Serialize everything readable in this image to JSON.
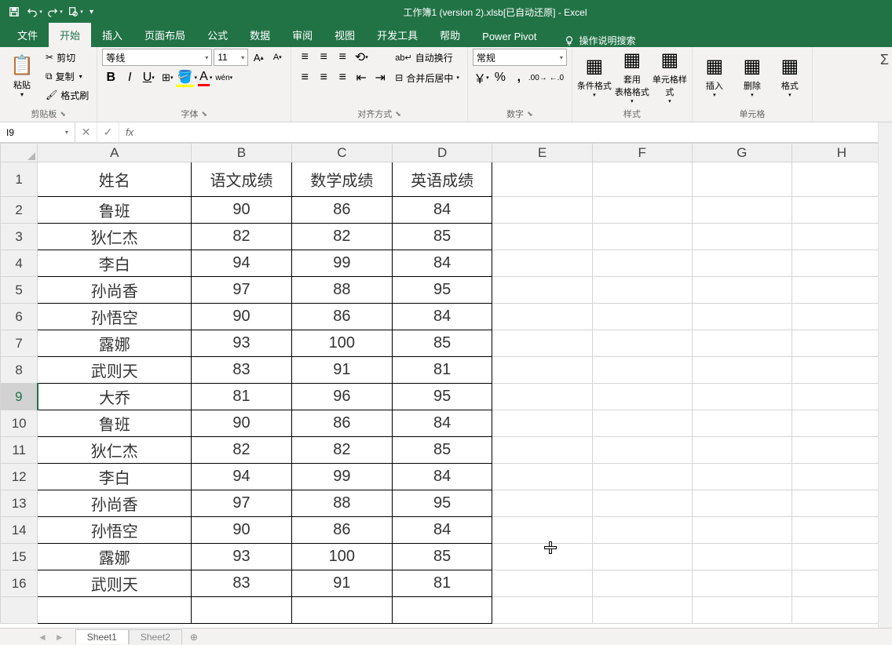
{
  "title": "工作簿1 (version 2).xlsb[已自动还原]  -  Excel",
  "ribbonTabs": [
    "文件",
    "开始",
    "插入",
    "页面布局",
    "公式",
    "数据",
    "审阅",
    "视图",
    "开发工具",
    "帮助",
    "Power Pivot"
  ],
  "activeTab": "开始",
  "tellMe": "操作说明搜索",
  "nameBox": "I9",
  "formula": "",
  "clipboard": {
    "paste": "粘贴",
    "cut": "剪切",
    "copy": "复制",
    "formatPainter": "格式刷",
    "group": "剪贴板"
  },
  "font": {
    "family": "等线",
    "size": "11",
    "group": "字体"
  },
  "alignment": {
    "wrap": "自动换行",
    "merge": "合并后居中",
    "group": "对齐方式"
  },
  "number": {
    "format": "常规",
    "group": "数字"
  },
  "styles": {
    "conditional": "条件格式",
    "tableFormat": "套用\n表格格式",
    "cellStyles": "单元格样式",
    "group": "样式"
  },
  "cells": {
    "insert": "插入",
    "delete": "删除",
    "format": "格式",
    "group": "单元格"
  },
  "columns": [
    "A",
    "B",
    "C",
    "D",
    "E",
    "F",
    "G",
    "H"
  ],
  "headers": {
    "name": "姓名",
    "chinese": "语文成绩",
    "math": "数学成绩",
    "english": "英语成绩"
  },
  "rows": [
    {
      "r": "1",
      "name": "姓名",
      "c": "语文成绩",
      "m": "数学成绩",
      "e": "英语成绩",
      "isHeader": true
    },
    {
      "r": "2",
      "name": "鲁班",
      "c": "90",
      "m": "86",
      "e": "84"
    },
    {
      "r": "3",
      "name": "狄仁杰",
      "c": "82",
      "m": "82",
      "e": "85"
    },
    {
      "r": "4",
      "name": "李白",
      "c": "94",
      "m": "99",
      "e": "84"
    },
    {
      "r": "5",
      "name": "孙尚香",
      "c": "97",
      "m": "88",
      "e": "95"
    },
    {
      "r": "6",
      "name": "孙悟空",
      "c": "90",
      "m": "86",
      "e": "84"
    },
    {
      "r": "7",
      "name": "露娜",
      "c": "93",
      "m": "100",
      "e": "85"
    },
    {
      "r": "8",
      "name": "武则天",
      "c": "83",
      "m": "91",
      "e": "81"
    },
    {
      "r": "9",
      "name": "大乔",
      "c": "81",
      "m": "96",
      "e": "95"
    },
    {
      "r": "10",
      "name": "鲁班",
      "c": "90",
      "m": "86",
      "e": "84"
    },
    {
      "r": "11",
      "name": "狄仁杰",
      "c": "82",
      "m": "82",
      "e": "85"
    },
    {
      "r": "12",
      "name": "李白",
      "c": "94",
      "m": "99",
      "e": "84"
    },
    {
      "r": "13",
      "name": "孙尚香",
      "c": "97",
      "m": "88",
      "e": "95"
    },
    {
      "r": "14",
      "name": "孙悟空",
      "c": "90",
      "m": "86",
      "e": "84"
    },
    {
      "r": "15",
      "name": "露娜",
      "c": "93",
      "m": "100",
      "e": "85"
    },
    {
      "r": "16",
      "name": "武则天",
      "c": "83",
      "m": "91",
      "e": "81"
    }
  ],
  "sheets": [
    "Sheet1",
    "Sheet2"
  ],
  "selectedRow": "9"
}
